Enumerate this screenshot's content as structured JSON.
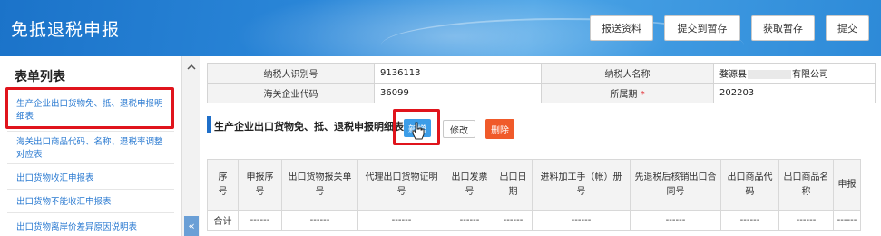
{
  "app_title": "免抵退税申报",
  "toolbar": [
    "报送资料",
    "提交到暂存",
    "获取暂存",
    "提交"
  ],
  "sidebar": {
    "title": "表单列表",
    "items": [
      "生产企业出口货物免、抵、退税申报明细表",
      "海关出口商品代码、名称、退税率调整对应表",
      "出口货物收汇申报表",
      "出口货物不能收汇申报表",
      "出口货物离岸价差异原因说明表"
    ]
  },
  "info": {
    "taxpayer_id_label": "纳税人识别号",
    "taxpayer_id_value": "9136113",
    "taxpayer_name_label": "纳税人名称",
    "taxpayer_name_prefix": "婺源县",
    "taxpayer_name_suffix": "有限公司",
    "customs_code_label": "海关企业代码",
    "customs_code_value": "36099",
    "period_label": "所属期",
    "period_required_mark": "*",
    "period_value": "202203"
  },
  "section": {
    "title": "生产企业出口货物免、抵、退税申报明细表",
    "add_label": "新增",
    "edit_label": "修改",
    "delete_label": "删除"
  },
  "grid": {
    "headers": [
      "序\n号",
      "申报序\n号",
      "出口货物报关单\n号",
      "代理出口货物证明\n号",
      "出口发票\n号",
      "出口日\n期",
      "进料加工手（帐）册\n号",
      "先退税后核销出口合\n同号",
      "出口商品代\n码",
      "出口商品名\n称",
      "申报"
    ],
    "total_row": [
      "合计",
      "------",
      "------",
      "------",
      "------",
      "------",
      "------",
      "------",
      "------",
      "------",
      "------"
    ]
  },
  "colors": {
    "header_blue": "#2a86d8",
    "highlight_red": "#e0141c",
    "add_button": "#3c9de8",
    "delete_button": "#f05a2a",
    "sidebar_link": "#2a7ad1"
  },
  "icons": {
    "scroll_up": "chevron-up-icon",
    "collapse": "double-chevron-left-icon",
    "cursor": "hand-pointer-icon"
  }
}
